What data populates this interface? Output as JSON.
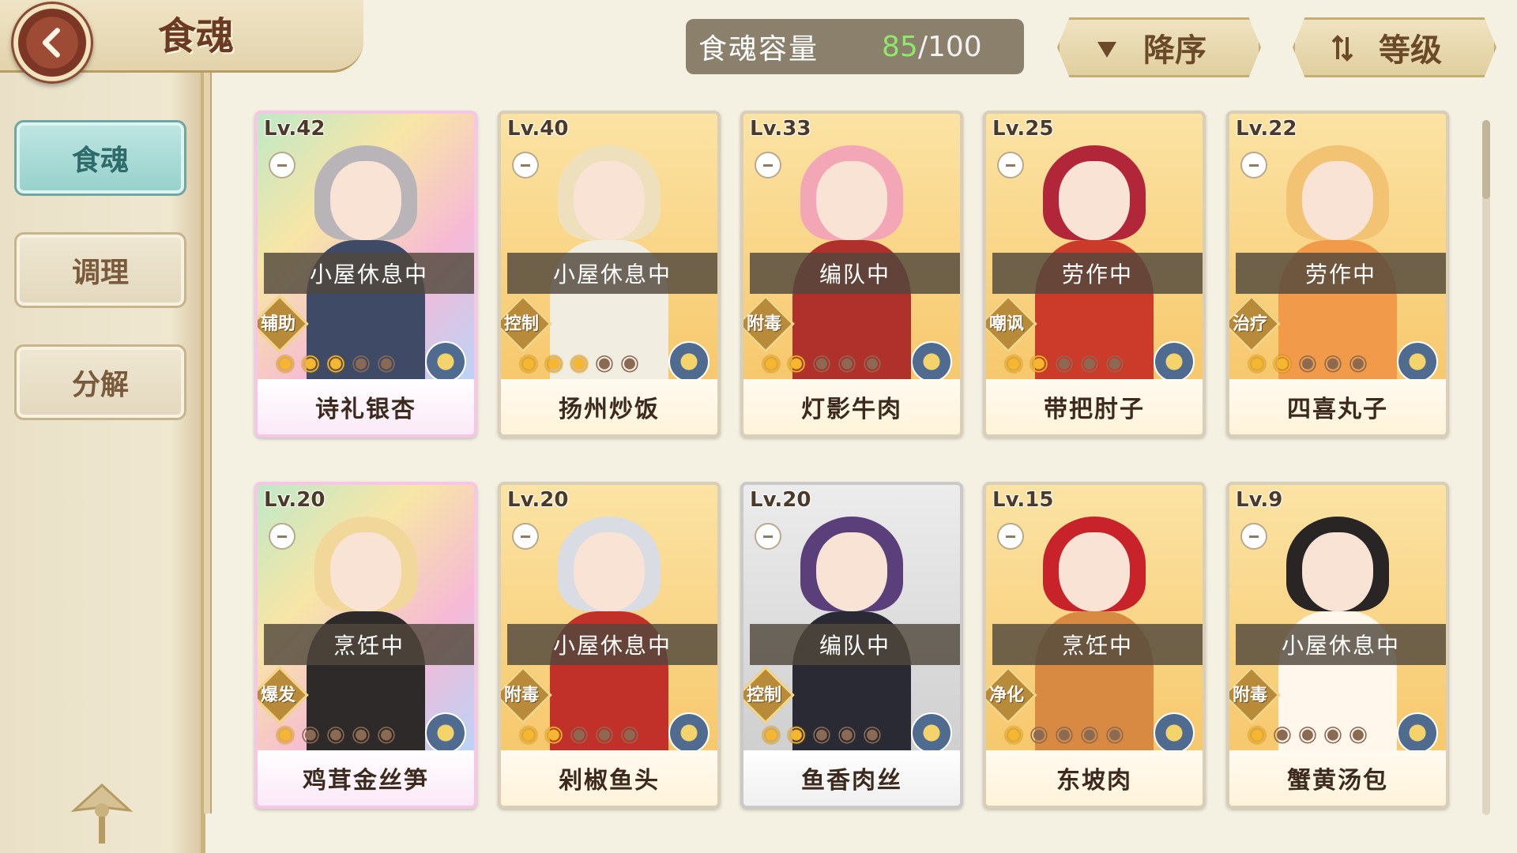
{
  "header": {
    "title": "食魂"
  },
  "sidebar": {
    "items": [
      {
        "label": "食魂",
        "active": true
      },
      {
        "label": "调理",
        "active": false
      },
      {
        "label": "分解",
        "active": false
      }
    ]
  },
  "capacity": {
    "label": "食魂容量",
    "current": "85",
    "max": "/100"
  },
  "controls": {
    "sort_order_label": "降序",
    "sort_key_label": "等级"
  },
  "colors": {
    "accent_teal": "#96d0cb",
    "capacity_green": "#8ee86a",
    "card_gold": "#f7c86c"
  },
  "cards": [
    {
      "level": "Lv.42",
      "status": "小屋休息中",
      "role": "辅助",
      "name": "诗礼银杏",
      "stars_on": 3,
      "stars_total": 5,
      "frame": "rainbow",
      "hair": "#b9b4b8",
      "body": "#3f4a66"
    },
    {
      "level": "Lv.40",
      "status": "小屋休息中",
      "role": "控制",
      "name": "扬州炒饭",
      "stars_on": 3,
      "stars_total": 5,
      "frame": "gold",
      "hair": "#efe0bd",
      "body": "#f2ede1"
    },
    {
      "level": "Lv.33",
      "status": "编队中",
      "role": "附毒",
      "name": "灯影牛肉",
      "stars_on": 2,
      "stars_total": 5,
      "frame": "gold",
      "hair": "#f3a6b5",
      "body": "#b0302c"
    },
    {
      "level": "Lv.25",
      "status": "劳作中",
      "role": "嘲讽",
      "name": "带把肘子",
      "stars_on": 2,
      "stars_total": 5,
      "frame": "gold",
      "hair": "#b2263a",
      "body": "#cc3a2a"
    },
    {
      "level": "Lv.22",
      "status": "劳作中",
      "role": "治疗",
      "name": "四喜丸子",
      "stars_on": 2,
      "stars_total": 5,
      "frame": "gold",
      "hair": "#f2c373",
      "body": "#f19a4a"
    },
    {
      "level": "Lv.20",
      "status": "烹饪中",
      "role": "爆发",
      "name": "鸡茸金丝笋",
      "stars_on": 1,
      "stars_total": 5,
      "frame": "rainbow",
      "hair": "#f2d79a",
      "body": "#2f2a2a"
    },
    {
      "level": "Lv.20",
      "status": "小屋休息中",
      "role": "附毒",
      "name": "剁椒鱼头",
      "stars_on": 2,
      "stars_total": 5,
      "frame": "gold",
      "hair": "#d9dde3",
      "body": "#c2302a"
    },
    {
      "level": "Lv.20",
      "status": "编队中",
      "role": "控制",
      "name": "鱼香肉丝",
      "stars_on": 2,
      "stars_total": 5,
      "frame": "silver",
      "hair": "#5b3f7a",
      "body": "#2a2a35"
    },
    {
      "level": "Lv.15",
      "status": "烹饪中",
      "role": "净化",
      "name": "东坡肉",
      "stars_on": 1,
      "stars_total": 5,
      "frame": "gold",
      "hair": "#c8232b",
      "body": "#d98a42"
    },
    {
      "level": "Lv.9",
      "status": "小屋休息中",
      "role": "附毒",
      "name": "蟹黄汤包",
      "stars_on": 1,
      "stars_total": 5,
      "frame": "gold",
      "hair": "#2a2525",
      "body": "#fff6ec"
    }
  ]
}
